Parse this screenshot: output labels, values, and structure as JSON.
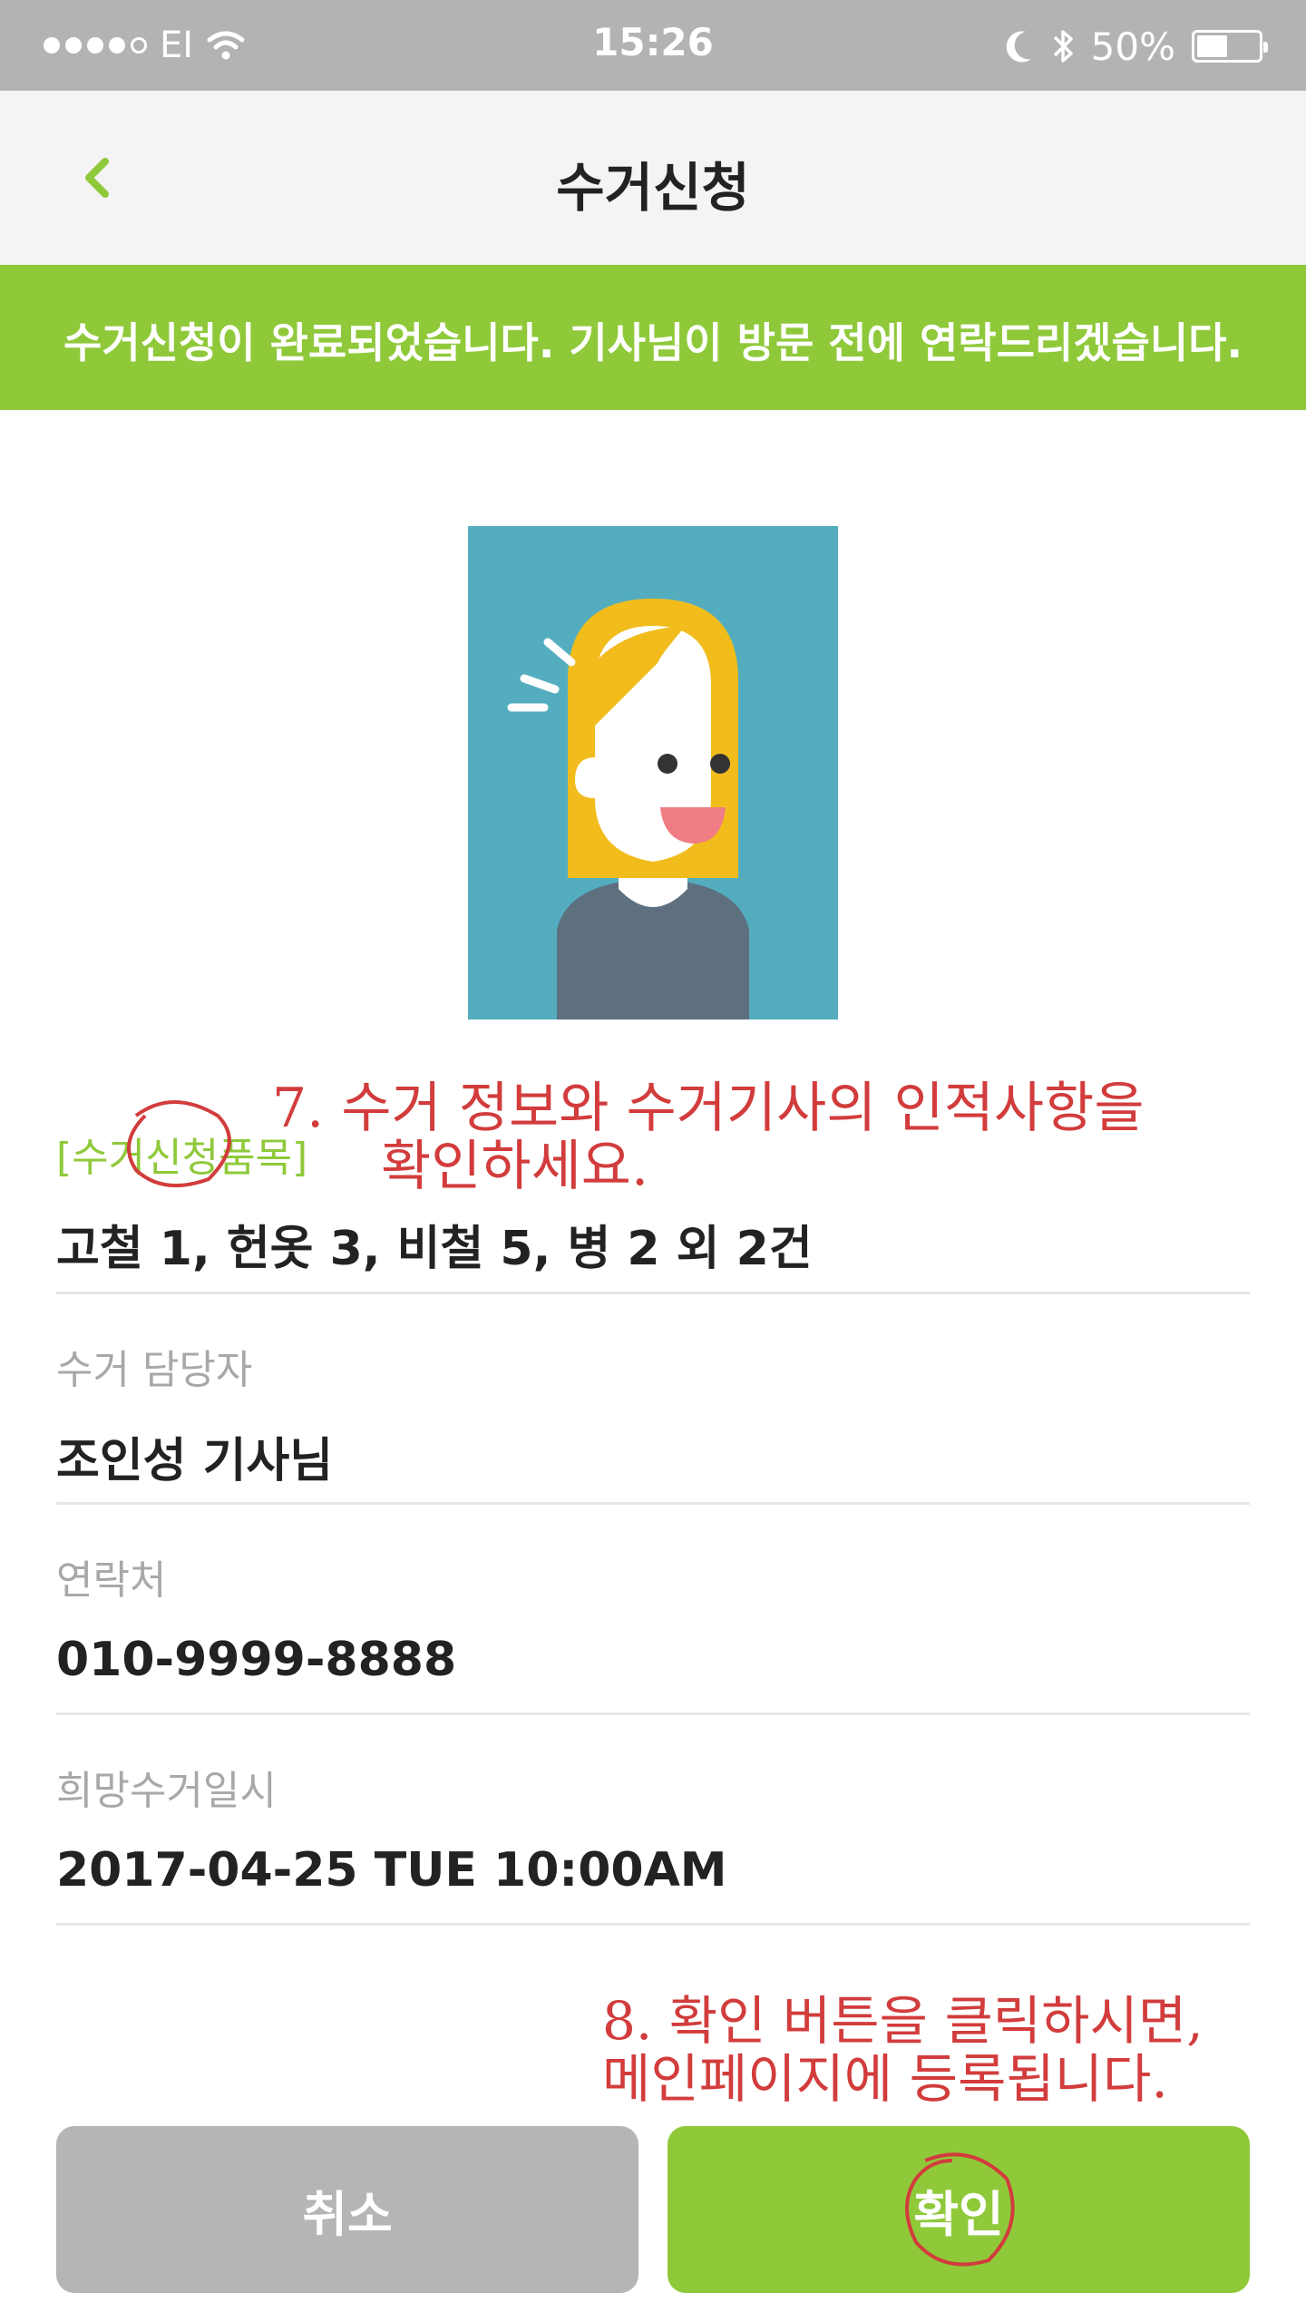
{
  "status_bar": {
    "carrier": "EI",
    "time": "15:26",
    "battery": "50%",
    "battery_level": 0.5
  },
  "nav": {
    "title": "수거신청",
    "back_icon": "chevron-left-icon"
  },
  "banner": {
    "message": "수거신청이 완료되었습니다. 기사님이 방문 전에 연락드리겠습니다."
  },
  "fields": [
    {
      "label": "[수거신청품목]",
      "value": "고철 1, 헌옷 3, 비철 5, 병 2 외 2건"
    },
    {
      "label": "수거 담당자",
      "value": "조인성 기사님"
    },
    {
      "label": "연락처",
      "value": "010-9999-8888"
    },
    {
      "label": "희망수거일시",
      "value": "2017-04-25 TUE 10:00AM"
    }
  ],
  "buttons": {
    "cancel": "취소",
    "confirm": "확인"
  },
  "annotations": {
    "note1_line1": "7. 수거 정보와 수거기사의 인적사항을",
    "note1_line2": "확인하세요.",
    "note2_line1": "8. 확인 버튼을 클릭하시면,",
    "note2_line2": "메인페이지에 등록됩니다."
  },
  "colors": {
    "accent": "#8fc93a",
    "annotation": "#d23c3c",
    "illustration_bg": "#54adbf",
    "hair": "#f1bc1c"
  }
}
